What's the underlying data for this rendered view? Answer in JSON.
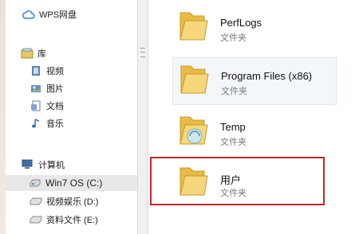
{
  "nav": {
    "wps": "WPS网盘",
    "library": "库",
    "videos": "视频",
    "pictures": "图片",
    "documents": "文档",
    "music": "音乐",
    "computer": "计算机",
    "drive_c": "Win7 OS (C:)",
    "drive_d": "视频娱乐 (D:)",
    "drive_e": "资料文件 (E:)"
  },
  "files": [
    {
      "name": "PerfLogs",
      "type": "文件夹"
    },
    {
      "name": "Program Files (x86)",
      "type": "文件夹"
    },
    {
      "name": "Temp",
      "type": "文件夹"
    },
    {
      "name": "用户",
      "type": "文件夹"
    }
  ],
  "icons": {
    "wps": "cloud-icon",
    "library": "library-icon",
    "videos": "video-icon",
    "pictures": "picture-icon",
    "documents": "document-icon",
    "music": "music-icon",
    "computer": "computer-icon",
    "drive": "drive-icon",
    "folder": "folder-icon"
  },
  "colors": {
    "highlight": "#c4262e",
    "folder": "#f3cf6c"
  }
}
